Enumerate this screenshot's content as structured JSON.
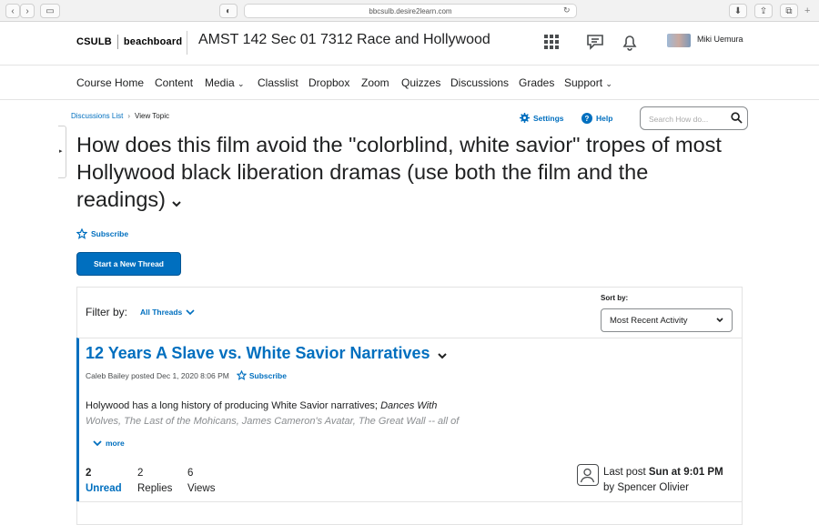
{
  "browser": {
    "url": "bbcsulb.desire2learn.com"
  },
  "minibar": {
    "logo_left": "CSULB",
    "logo_right": "beachboard",
    "course_title": "AMST 142 Sec 01 7312 Race and Hollywood",
    "user_name": "Miki Uemura"
  },
  "navbar": {
    "items": [
      "Course Home",
      "Content",
      "Media",
      "Classlist",
      "Dropbox",
      "Zoom",
      "Quizzes",
      "Discussions",
      "Grades",
      "Support"
    ]
  },
  "breadcrumbs": {
    "parent": "Discussions List",
    "current": "View Topic"
  },
  "toolbar": {
    "settings": "Settings",
    "help": "Help",
    "search_placeholder": "Search How do..."
  },
  "topic": {
    "title": "How does this film avoid the \"colorblind, white savior\" tropes of most Hollywood black liberation dramas (use both the film and the readings)",
    "subscribe": "Subscribe",
    "start_thread": "Start a New Thread"
  },
  "filter": {
    "label": "Filter by:",
    "value": "All Threads",
    "sort_label": "Sort by:",
    "sort_value": "Most Recent Activity"
  },
  "thread": {
    "title": "12 Years A Slave vs. White Savior Narratives",
    "author_line": "Caleb Bailey posted Dec 1, 2020 8:06 PM",
    "subscribe": "Subscribe",
    "excerpt_line1_plain": "Holywood has a long history of producing White Savior narratives; ",
    "excerpt_line1_italic": "Dances With",
    "excerpt_line2": "Wolves, The Last of the Mohicans, James Cameron's Avatar, The Great Wall -- all of",
    "more": "more",
    "unread_count": "2",
    "unread_label": "Unread",
    "replies_count": "2",
    "replies_label": "Replies",
    "views_count": "6",
    "views_label": "Views",
    "last_post_prefix": "Last post ",
    "last_post_time": "Sun at 9:01 PM",
    "last_post_by": "by Spencer Olivier"
  },
  "colors": {
    "accent": "#006fbf",
    "text": "#202122"
  }
}
